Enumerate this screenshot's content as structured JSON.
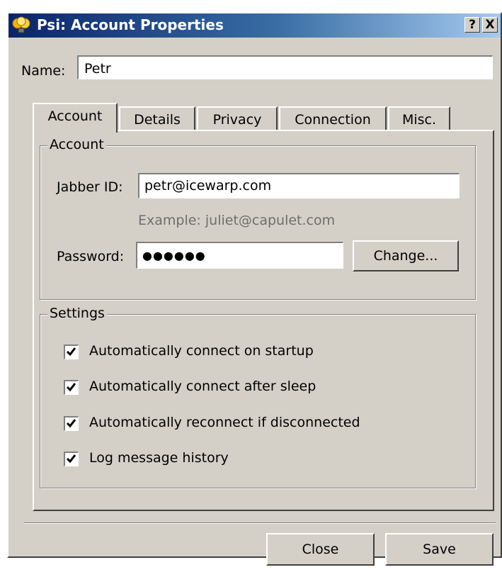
{
  "window": {
    "title": "Psi: Account Properties",
    "help_glyph": "?",
    "close_glyph": "X"
  },
  "name": {
    "label": "Name:",
    "value": "Petr"
  },
  "tabs": [
    {
      "label": "Account",
      "active": true
    },
    {
      "label": "Details",
      "active": false
    },
    {
      "label": "Privacy",
      "active": false
    },
    {
      "label": "Connection",
      "active": false
    },
    {
      "label": "Misc.",
      "active": false
    }
  ],
  "account_group": {
    "legend": "Account",
    "jid_label": "Jabber ID:",
    "jid_value": "petr@icewarp.com",
    "example": "Example: juliet@capulet.com",
    "password_label": "Password:",
    "password_value": "●●●●●●",
    "change_button": "Change..."
  },
  "settings_group": {
    "legend": "Settings",
    "options": [
      {
        "label": "Automatically connect on startup",
        "checked": true
      },
      {
        "label": "Automatically connect after sleep",
        "checked": true
      },
      {
        "label": "Automatically reconnect if disconnected",
        "checked": true
      },
      {
        "label": "Log message history",
        "checked": true
      }
    ]
  },
  "footer": {
    "close_button": "Close",
    "save_button": "Save"
  },
  "icons": {
    "app": "psi-lightbulb-icon",
    "check": "checkmark-icon"
  }
}
